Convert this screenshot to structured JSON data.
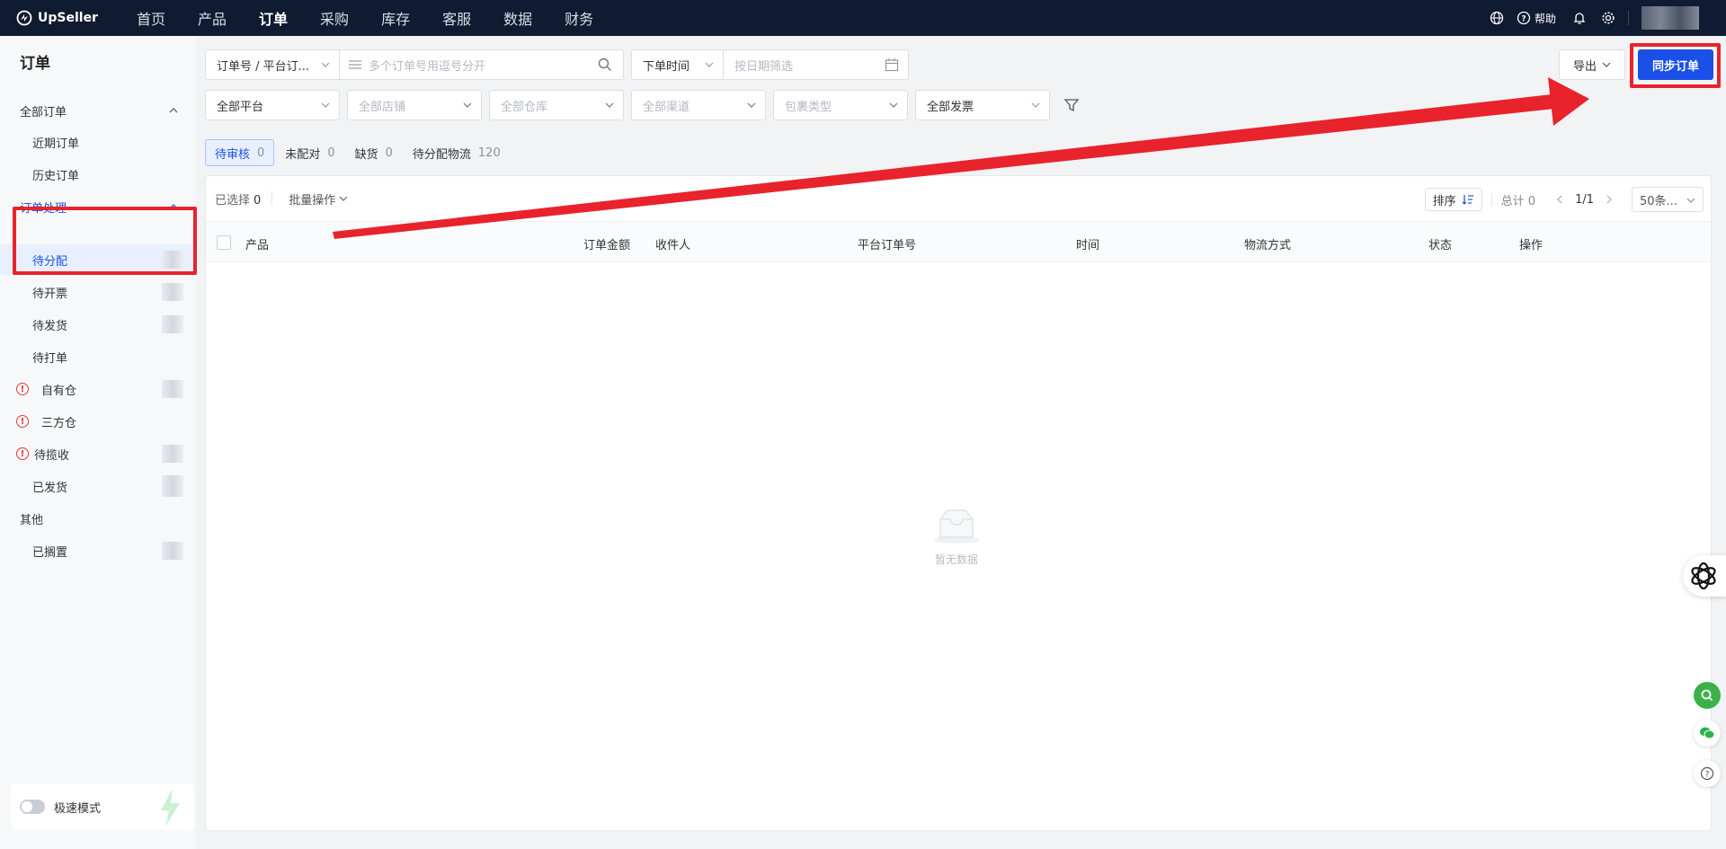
{
  "app": {
    "brand": "UpSeller",
    "nav": [
      "首页",
      "产品",
      "订单",
      "采购",
      "库存",
      "客服",
      "数据",
      "财务"
    ],
    "nav_active_index": 2,
    "help_label": "帮助"
  },
  "sidebar": {
    "title": "订单",
    "all_orders": "全部订单",
    "recent_orders": "近期订单",
    "history_orders": "历史订单",
    "processing": "订单处理",
    "pending_assign": "待分配",
    "pending_invoice": "待开票",
    "pending_ship": "待发货",
    "pending_print": "待打单",
    "own_warehouse": "自有仓",
    "third_warehouse": "三方仓",
    "pending_pickup": "待揽收",
    "shipped": "已发货",
    "others": "其他",
    "on_hold": "已搁置",
    "speed_mode": "极速模式"
  },
  "filters": {
    "order_field": "订单号 / 平台订...",
    "order_placeholder": "多个订单号用逗号分开",
    "time_field": "下单时间",
    "date_placeholder": "按日期筛选",
    "platform": "全部平台",
    "store": "全部店铺",
    "warehouse": "全部仓库",
    "channel": "全部渠道",
    "package_type": "包裹类型",
    "invoice": "全部发票",
    "export": "导出",
    "sync": "同步订单"
  },
  "tabs": [
    {
      "label": "待审核",
      "count": "0"
    },
    {
      "label": "未配对",
      "count": "0"
    },
    {
      "label": "缺货",
      "count": "0"
    },
    {
      "label": "待分配物流",
      "count": "120"
    }
  ],
  "table": {
    "selected_label": "已选择",
    "selected_count": "0",
    "bulk_label": "批量操作",
    "sort_label": "排序",
    "total_label": "总计 0",
    "page": "1/1",
    "page_size": "50条...",
    "columns": [
      "产品",
      "订单金额",
      "收件人",
      "平台订单号",
      "时间",
      "物流方式",
      "状态",
      "操作"
    ],
    "empty_text": "暂无数据"
  },
  "colors": {
    "topbar": "#0f1b30",
    "primary": "#1a4fe8",
    "annotation": "#e8232c"
  }
}
